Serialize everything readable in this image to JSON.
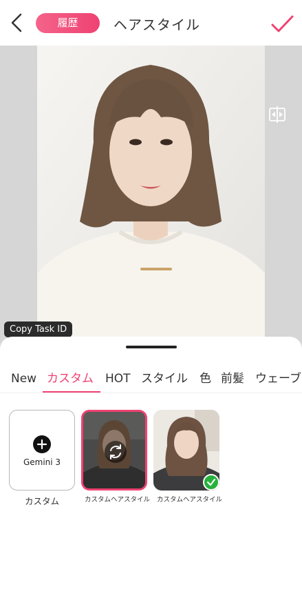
{
  "header": {
    "history_label": "履歴",
    "title": "ヘアスタイル",
    "back_icon": "chevron-left-icon",
    "confirm_icon": "check-icon",
    "accent_color": "#ef4272"
  },
  "preview": {
    "compare_icon": "split-compare-icon",
    "tooltip": "Copy Task ID",
    "download_icon": "download-icon"
  },
  "tabs": [
    {
      "label": "New",
      "active": false
    },
    {
      "label": "カスタム",
      "active": true
    },
    {
      "label": "HOT",
      "active": false
    },
    {
      "label": "スタイル",
      "active": false
    },
    {
      "label": "色",
      "active": false
    },
    {
      "label": "前髪",
      "active": false
    },
    {
      "label": "ウェーブ",
      "active": false
    }
  ],
  "cards": {
    "add_model": "Gemini 3",
    "add_caption": "カスタム",
    "item1_caption": "カスタムヘアスタイル",
    "item2_caption": "カスタムヘアスタイル"
  }
}
